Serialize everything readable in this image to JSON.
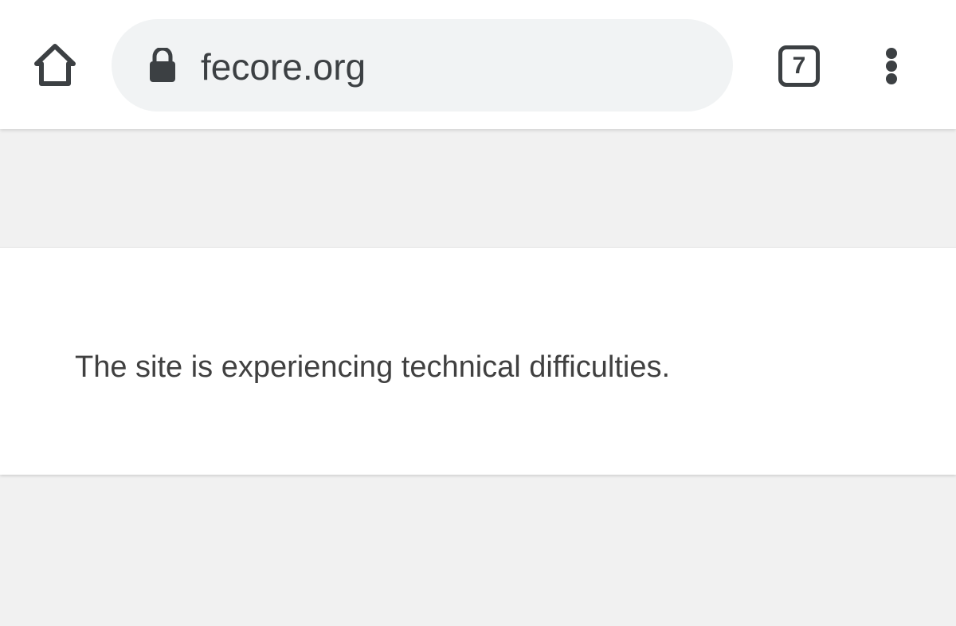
{
  "toolbar": {
    "home_icon": "home-icon",
    "lock_icon": "lock-icon",
    "url": "fecore.org",
    "tab_count": "7",
    "menu_icon": "more-vert-icon"
  },
  "page": {
    "message": "The site is experiencing technical difficulties."
  },
  "colors": {
    "toolbar_background": "#ffffff",
    "omnibox_background": "#f1f3f4",
    "icon_color": "#3c4043",
    "page_background": "#f1f1f1",
    "card_background": "#ffffff",
    "message_text": "#404040"
  }
}
